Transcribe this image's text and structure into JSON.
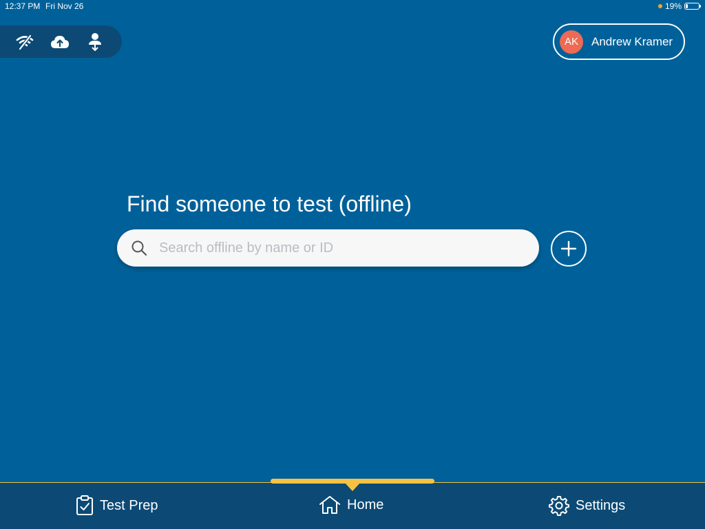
{
  "status_bar": {
    "time": "12:37 PM",
    "date": "Fri Nov 26",
    "battery": "19%",
    "battery_level": 0.19
  },
  "sync_toolbar": {
    "icons": [
      "wifi-off-icon",
      "cloud-upload-icon",
      "person-download-icon"
    ]
  },
  "user": {
    "initials": "AK",
    "name": "Andrew Kramer",
    "avatar_color": "#ee6a55"
  },
  "main": {
    "title": "Find someone to test (offline)",
    "search_placeholder": "Search offline by name or ID",
    "search_value": ""
  },
  "bottom_nav": {
    "items": [
      {
        "label": "Test Prep",
        "icon": "clipboard-check-icon"
      },
      {
        "label": "Home",
        "icon": "home-icon",
        "active": true
      },
      {
        "label": "Settings",
        "icon": "gear-icon"
      }
    ]
  },
  "colors": {
    "background": "#00619a",
    "nav_background": "#0c4a75",
    "accent": "#f7c244"
  }
}
